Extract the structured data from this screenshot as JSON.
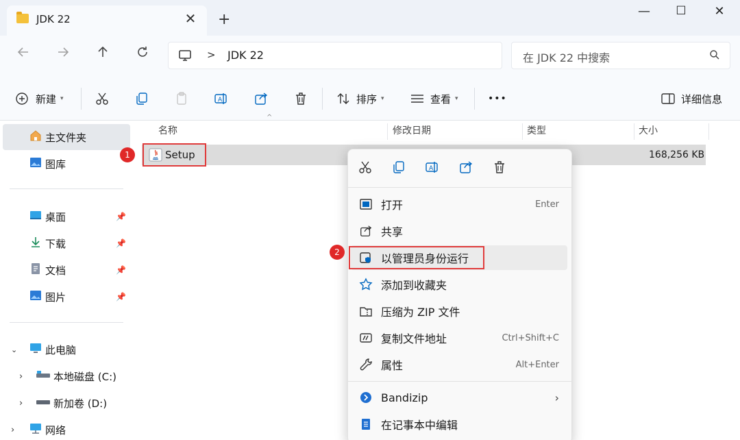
{
  "window": {
    "tab_title": "JDK 22",
    "new_tab": "+",
    "min": "—",
    "max": "☐",
    "close": "✕"
  },
  "nav": {
    "breadcrumb": "JDK 22",
    "breadcrumb_sep": ">",
    "search_placeholder": "在 JDK 22 中搜索"
  },
  "toolbar": {
    "new_label": "新建",
    "sort_label": "排序",
    "view_label": "查看",
    "more_label": "•••",
    "details_label": "详细信息"
  },
  "sidebar": {
    "items": [
      {
        "label": "主文件夹",
        "icon": "home-icon"
      },
      {
        "label": "图库",
        "icon": "gallery-icon"
      },
      {
        "label": "桌面",
        "icon": "desktop-icon"
      },
      {
        "label": "下载",
        "icon": "download-icon"
      },
      {
        "label": "文档",
        "icon": "documents-icon"
      },
      {
        "label": "图片",
        "icon": "pictures-icon"
      },
      {
        "label": "此电脑",
        "icon": "computer-icon"
      },
      {
        "label": "本地磁盘 (C:)",
        "icon": "drive-c-icon"
      },
      {
        "label": "新加卷 (D:)",
        "icon": "drive-d-icon"
      },
      {
        "label": "网络",
        "icon": "network-icon"
      }
    ]
  },
  "columns": {
    "name": "名称",
    "modified": "修改日期",
    "type": "类型",
    "size": "大小"
  },
  "files": [
    {
      "name": "Setup",
      "size": "168,256 KB"
    }
  ],
  "annotations": {
    "step1": "1",
    "step2": "2"
  },
  "context_menu": {
    "items": [
      {
        "label": "打开",
        "shortcut": "Enter",
        "icon": "open-icon"
      },
      {
        "label": "共享",
        "shortcut": "",
        "icon": "share-icon"
      },
      {
        "label": "以管理员身份运行",
        "shortcut": "",
        "icon": "admin-shield-icon"
      },
      {
        "label": "添加到收藏夹",
        "shortcut": "",
        "icon": "star-icon"
      },
      {
        "label": "压缩为 ZIP 文件",
        "shortcut": "",
        "icon": "zip-icon"
      },
      {
        "label": "复制文件地址",
        "shortcut": "Ctrl+Shift+C",
        "icon": "copy-path-icon"
      },
      {
        "label": "属性",
        "shortcut": "Alt+Enter",
        "icon": "wrench-icon"
      },
      {
        "label": "Bandizip",
        "shortcut": "",
        "icon": "bandizip-icon"
      },
      {
        "label": "在记事本中编辑",
        "shortcut": "",
        "icon": "notepad-icon"
      }
    ]
  },
  "colors": {
    "accent": "#0067c0",
    "annotation_red": "#e02828"
  }
}
